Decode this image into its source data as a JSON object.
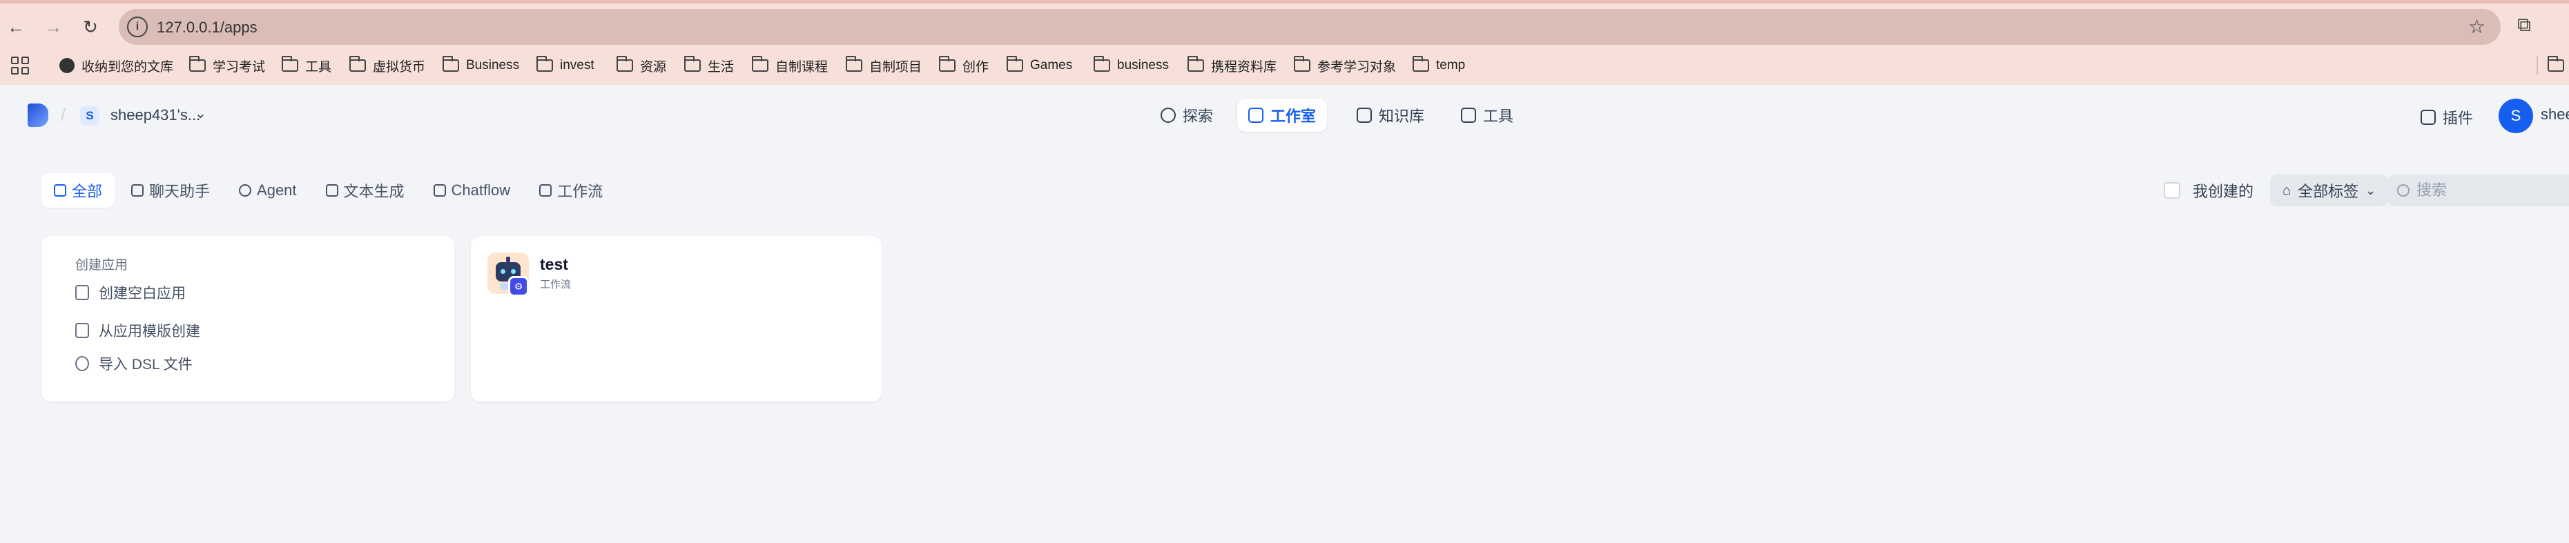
{
  "browser": {
    "url": "127.0.0.1/apps",
    "bookmarks": [
      {
        "label": "收纳到您的文库",
        "icon": "globe-icon"
      },
      {
        "label": "学习考试",
        "icon": "folder-icon"
      },
      {
        "label": "工具",
        "icon": "folder-icon"
      },
      {
        "label": "虚拟货币",
        "icon": "folder-icon"
      },
      {
        "label": "Business",
        "icon": "folder-icon"
      },
      {
        "label": "invest",
        "icon": "folder-icon"
      },
      {
        "label": "资源",
        "icon": "folder-icon"
      },
      {
        "label": "生活",
        "icon": "folder-icon"
      },
      {
        "label": "自制课程",
        "icon": "folder-icon"
      },
      {
        "label": "自制项目",
        "icon": "folder-icon"
      },
      {
        "label": "创作",
        "icon": "folder-icon"
      },
      {
        "label": "Games",
        "icon": "folder-icon"
      },
      {
        "label": "business",
        "icon": "folder-icon"
      },
      {
        "label": "携程资料库",
        "icon": "folder-icon"
      },
      {
        "label": "参考学习对象",
        "icon": "folder-icon"
      },
      {
        "label": "temp",
        "icon": "folder-icon"
      }
    ]
  },
  "header": {
    "workspace_initial": "S",
    "workspace_name": "sheep431's...",
    "nav": [
      {
        "label": "探索",
        "icon": "compass-icon"
      },
      {
        "label": "工作室",
        "icon": "robot-icon",
        "active": true
      },
      {
        "label": "知识库",
        "icon": "book-icon"
      },
      {
        "label": "工具",
        "icon": "hammer-icon"
      }
    ],
    "plugin_label": "插件",
    "user_initial": "S",
    "user_name": "sheep"
  },
  "filters": {
    "tabs": [
      {
        "label": "全部",
        "active": true
      },
      {
        "label": "聊天助手"
      },
      {
        "label": "Agent"
      },
      {
        "label": "文本生成"
      },
      {
        "label": "Chatflow"
      },
      {
        "label": "工作流"
      }
    ],
    "mine_label": "我创建的",
    "tag_label": "全部标签",
    "search_placeholder": "搜索"
  },
  "create_card": {
    "title": "创建应用",
    "items": [
      {
        "label": "创建空白应用",
        "icon": "new-file-icon"
      },
      {
        "label": "从应用模版创建",
        "icon": "template-icon"
      },
      {
        "label": "导入 DSL 文件",
        "icon": "import-icon"
      }
    ]
  },
  "apps": [
    {
      "name": "test",
      "type": "工作流",
      "icon": "robot-avatar-icon",
      "badge_icon": "workflow-badge-icon"
    }
  ],
  "colors": {
    "accent": "#155eef",
    "chrome_bg": "#f7e0da",
    "page_bg": "#f2f4f7"
  }
}
